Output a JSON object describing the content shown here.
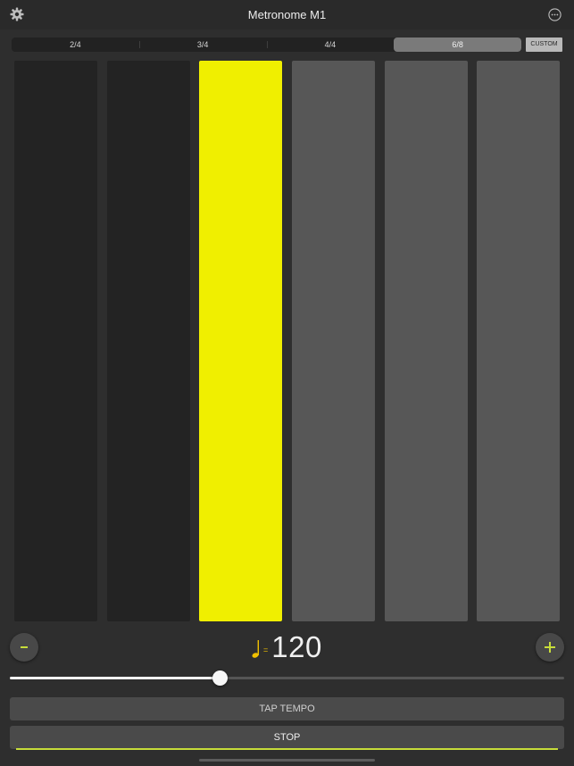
{
  "header": {
    "title": "Metronome M1",
    "settings_icon": "gear-icon",
    "more_icon": "more-options-icon"
  },
  "time_signatures": {
    "options": [
      "2/4",
      "3/4",
      "4/4",
      "6/8"
    ],
    "selected": "6/8",
    "custom_label": "CUSTOM"
  },
  "beats": {
    "count": 6,
    "current_beat": 3,
    "colors": {
      "past": "#232323",
      "current": "#f0ef00",
      "future": "#575757"
    }
  },
  "tempo": {
    "note_icon": "quarter-note-icon",
    "equals": "=",
    "bpm": "120",
    "decrement_icon": "minus-icon",
    "increment_icon": "plus-icon",
    "slider_fraction": 0.38
  },
  "controls": {
    "tap_tempo": "TAP TEMPO",
    "stop": "STOP"
  },
  "colors": {
    "accent_yellow": "#f0ef00",
    "accent_green": "#c7dd3a",
    "note_gold": "#f0c000"
  }
}
